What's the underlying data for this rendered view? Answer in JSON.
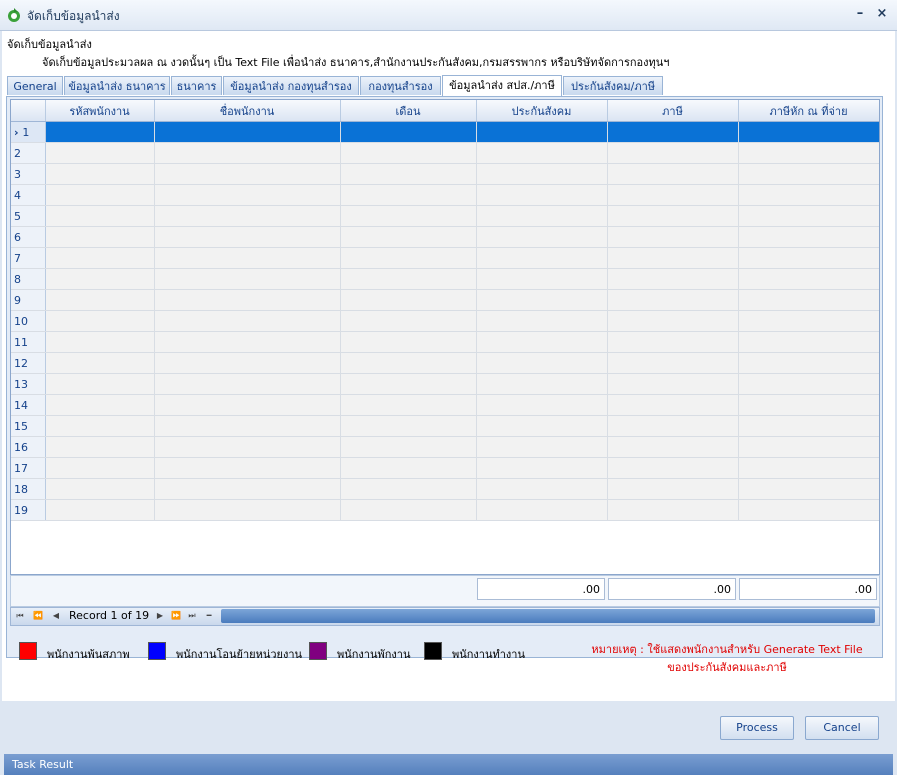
{
  "window": {
    "title": "จัดเก็บข้อมูลนำส่ง",
    "minimize_glyph": "–",
    "close_glyph": "×"
  },
  "header": {
    "title": "จัดเก็บข้อมูลนำส่ง",
    "description": "จัดเก็บข้อมูลประมวลผล ณ งวดนั้นๆ เป็น Text File เพื่อนำส่ง ธนาคาร,สำนักงานประกันสังคม,กรมสรรพากร หรือบริษัทจัดการกองทุนฯ"
  },
  "tabs": [
    {
      "label": "General",
      "active": false
    },
    {
      "label": "ข้อมูลนำส่ง ธนาคาร",
      "active": false
    },
    {
      "label": "ธนาคาร",
      "active": false
    },
    {
      "label": "ข้อมูลนำส่ง กองทุนสำรอง",
      "active": false
    },
    {
      "label": "กองทุนสำรอง",
      "active": false
    },
    {
      "label": "ข้อมูลนำส่ง สปส./ภาษี",
      "active": true
    },
    {
      "label": "ประกันสังคม/ภาษี",
      "active": false
    }
  ],
  "grid": {
    "columns": [
      "รหัสพนักงาน",
      "ชื่อพนักงาน",
      "เดือน",
      "ประกันสังคม",
      "ภาษี",
      "ภาษีหัก ณ ที่จ่าย"
    ],
    "rows": [
      "1",
      "2",
      "3",
      "4",
      "5",
      "6",
      "7",
      "8",
      "9",
      "10",
      "11",
      "12",
      "13",
      "14",
      "15",
      "16",
      "17",
      "18",
      "19"
    ],
    "selected_row": 1,
    "totals": {
      "social_security": ".00",
      "tax": ".00",
      "withholding_tax": ".00"
    }
  },
  "navigator": {
    "record_text": "Record 1 of 19"
  },
  "legend": [
    {
      "label": "พนักงานพ้นสภาพ",
      "color": "#ff0000"
    },
    {
      "label": "พนักงานโอนย้ายหน่วยงาน",
      "color": "#0000ff"
    },
    {
      "label": "พนักงานพักงาน",
      "color": "#800080"
    },
    {
      "label": "พนักงานทำงาน",
      "color": "#000000"
    }
  ],
  "note": {
    "line1": "หมายเหตุ : ใช้แสดงพนักงานสำหรับ Generate Text File",
    "line2": "ของประกันสังคมและภาษี",
    "color": "#e00000"
  },
  "buttons": {
    "process": "Process",
    "cancel": "Cancel"
  },
  "status": {
    "task_result": "Task Result"
  }
}
